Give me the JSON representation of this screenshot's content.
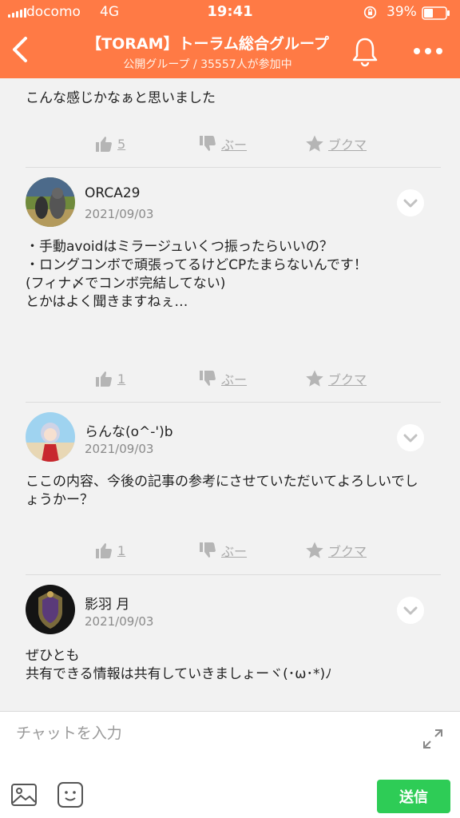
{
  "status_bar": {
    "carrier": "docomo",
    "network": "4G",
    "time": "19:41",
    "battery": "39%"
  },
  "nav": {
    "title": "【TORAM】トーラム総合グループ",
    "subtitle": "公開グループ / 35557人が参加中",
    "back_icon": "chevron-left-icon",
    "bell_icon": "bell-icon",
    "more_icon": "more-dots-icon"
  },
  "actions": {
    "like_icon": "thumbs-up-icon",
    "boo_label": "ぶー",
    "boo_icon": "thumbs-down-icon",
    "bookmark_label": "ブクマ",
    "bookmark_icon": "star-icon"
  },
  "posts": [
    {
      "body": "こんな感じかなぁと思いました",
      "likes": "5"
    },
    {
      "username": "ORCA29",
      "date": "2021/09/03",
      "body": "・手動avoidはミラージュいくつ振ったらいいの？\n・ロングコンボで頑張ってるけどCPたまらないんです！\n(フィナ〆でコンボ完結してない)\nとかはよく聞きますねぇ…",
      "likes": "1"
    },
    {
      "username": "らんな(o^-')b",
      "date": "2021/09/03",
      "body": "ここの内容、今後の記事の参考にさせていただいてよろしいでしょうかー？",
      "likes": "1"
    },
    {
      "username": "影羽 月",
      "date": "2021/09/03",
      "body": "ぜひとも\n共有できる情報は共有していきましょーヾ(･ω･*)ﾉ"
    }
  ],
  "composer": {
    "placeholder": "チャットを入力",
    "send_label": "送信",
    "image_icon": "image-icon",
    "sticker_icon": "sticker-icon",
    "expand_icon": "expand-icon"
  },
  "colors": {
    "header": "#ff7a45",
    "send": "#2ecc56",
    "muted": "#aaaaaa"
  }
}
